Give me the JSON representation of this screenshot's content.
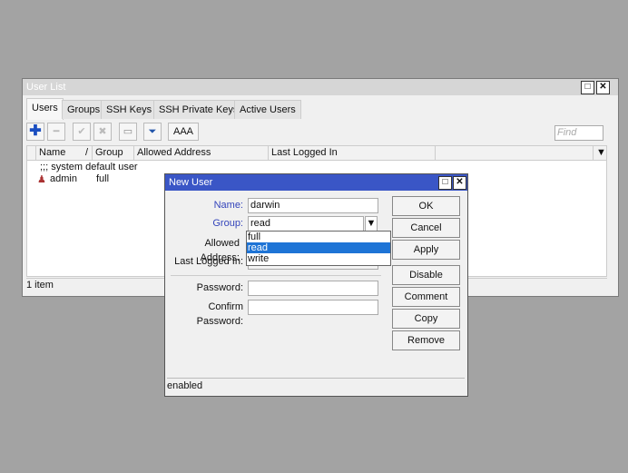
{
  "user_list": {
    "title": "User List",
    "tabs": [
      "Users",
      "Groups",
      "SSH Keys",
      "SSH Private Keys",
      "Active Users"
    ],
    "aaa_label": "AAA",
    "find_placeholder": "Find",
    "columns": [
      "Name",
      "Group",
      "Allowed Address",
      "Last Logged In"
    ],
    "comment_row": ";;; system default user",
    "rows": [
      {
        "name": "admin",
        "group": "full"
      }
    ],
    "status": "1 item"
  },
  "new_user": {
    "title": "New User",
    "name_label": "Name:",
    "name_value": "darwin",
    "group_label": "Group:",
    "group_value": "read",
    "group_options": [
      "full",
      "read",
      "write"
    ],
    "selected_option": "read",
    "allowed_address_label": "Allowed Address:",
    "last_logged_in_label": "Last Logged In:",
    "password_label": "Password:",
    "confirm_password_label": "Confirm Password:",
    "buttons": [
      "OK",
      "Cancel",
      "Apply",
      "Disable",
      "Comment",
      "Copy",
      "Remove"
    ],
    "status": "enabled"
  },
  "colors": {
    "title_active": "#3a56c6",
    "selection": "#1e74d6",
    "label_blue": "#3344bb"
  }
}
